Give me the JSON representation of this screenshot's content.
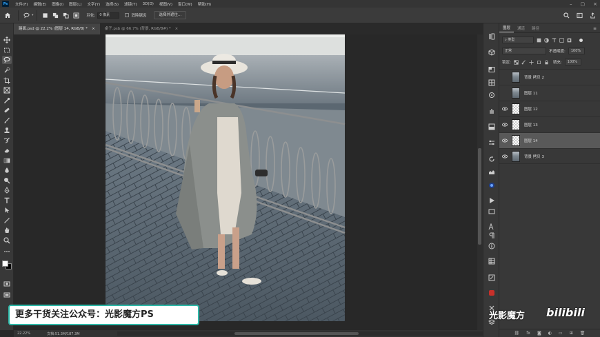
{
  "menu": [
    "文件(F)",
    "编辑(E)",
    "图像(I)",
    "图层(L)",
    "文字(Y)",
    "选择(S)",
    "滤镜(T)",
    "3D(D)",
    "视图(V)",
    "窗口(W)",
    "帮助(H)"
  ],
  "app_icon": "Ps",
  "options": {
    "feather_label": "羽化:",
    "feather_value": "0 像素",
    "antialias_label": "消除锯齿",
    "select_subject_button": "选择并遮住..."
  },
  "tabs": [
    {
      "label": "路面.psd @ 22.2% (图层 14, RGB/8) *",
      "close": "×"
    },
    {
      "label": "桌子.psb @ 66.7% (背景, RGB/8#) *",
      "close": "×"
    }
  ],
  "status": {
    "zoom": "22.22%",
    "doc": "文档:51.3M/187.3M"
  },
  "panel": {
    "tabs": [
      "图层",
      "通道",
      "路径"
    ],
    "filter_kind": "类型",
    "blend_mode": "正常",
    "opacity_label": "不透明度:",
    "opacity_value": "100%",
    "lock_label": "锁定:",
    "fill_label": "填充:",
    "fill_value": "100%"
  },
  "layers": [
    {
      "name": "背景 拷贝 2",
      "visible": false,
      "selected": false,
      "thumb": "photo"
    },
    {
      "name": "图层 11",
      "visible": false,
      "selected": false,
      "thumb": "photo"
    },
    {
      "name": "图层 12",
      "visible": true,
      "selected": false,
      "thumb": "trans"
    },
    {
      "name": "图层 13",
      "visible": true,
      "selected": false,
      "thumb": "trans"
    },
    {
      "name": "图层 14",
      "visible": true,
      "selected": true,
      "thumb": "trans"
    },
    {
      "name": "背景 拷贝 3",
      "visible": true,
      "selected": false,
      "thumb": "photo"
    }
  ],
  "footer_icons": [
    "link-icon",
    "fx-icon",
    "mask-icon",
    "adjustment-icon",
    "folder-icon",
    "new-layer-icon",
    "trash-icon"
  ],
  "footer_fx": "fx",
  "watermark": {
    "banner": "更多干货关注公众号：光影魔方PS",
    "brand": "光影魔方",
    "bili": "bilibili"
  }
}
